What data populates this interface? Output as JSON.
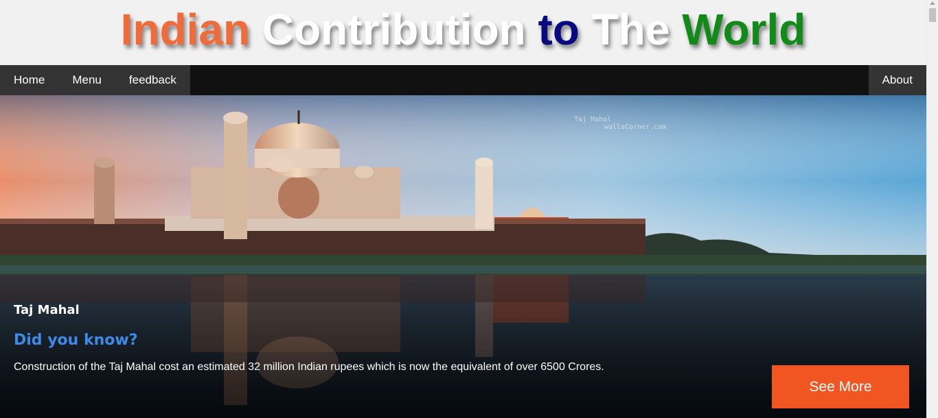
{
  "header": {
    "title_words": [
      "Indian",
      "Contribution",
      "to",
      "The",
      "World"
    ],
    "colors": {
      "orange": "#ef6b3a",
      "white": "#ffffff",
      "navy": "#0a0a80",
      "green": "#118a1a"
    }
  },
  "nav": {
    "items": [
      {
        "label": "Home"
      },
      {
        "label": "Menu"
      },
      {
        "label": "feedback"
      }
    ],
    "right_item": {
      "label": "About"
    },
    "colors": {
      "bar": "#111111",
      "item_bg": "#333333"
    }
  },
  "hero": {
    "watermark_line1": "Taj Mahal",
    "watermark_line2": "wallsCorner.com",
    "title": "Taj Mahal",
    "heading": "Did you know?",
    "text": "Construction of the Taj Mahal cost an estimated 32 million Indian rupees which is now the equivalent of over 6500 Crores.",
    "button_label": "See More",
    "colors": {
      "heading": "#3d8be8",
      "button": "#f05522"
    }
  }
}
